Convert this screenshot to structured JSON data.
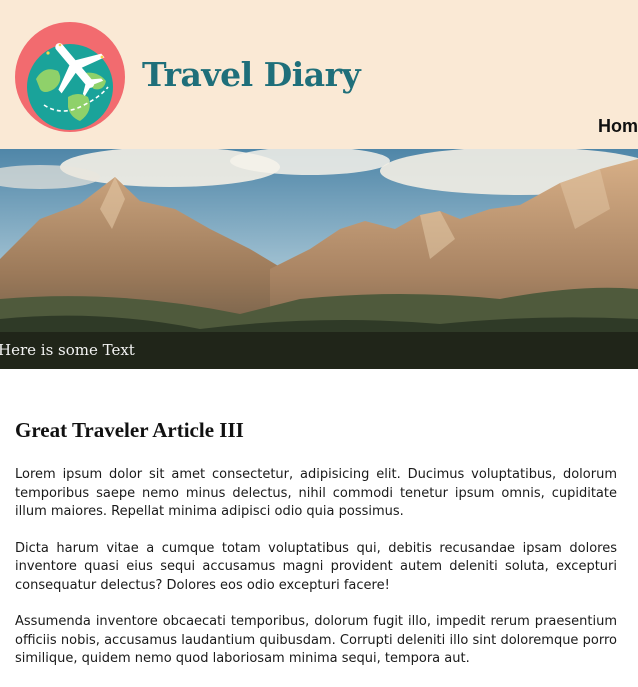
{
  "header": {
    "site_title": "Travel Diary",
    "logo_icon": "globe-airplane-icon",
    "colors": {
      "background": "#fae9d5",
      "title": "#1f6f7a",
      "logo_circle": "#f26b6f",
      "globe": "#1aa39a"
    }
  },
  "nav": {
    "home_label": "Hom"
  },
  "hero": {
    "image": "mountain-landscape",
    "caption": "Here is some Text"
  },
  "article": {
    "title": "Great Traveler Article III",
    "paragraphs": [
      "Lorem ipsum dolor sit amet consectetur, adipisicing elit. Ducimus voluptatibus, dolorum temporibus saepe nemo minus delectus, nihil commodi tenetur ipsum omnis, cupiditate illum maiores. Repellat minima adipisci odio quia possimus.",
      "Dicta harum vitae a cumque totam voluptatibus qui, debitis recusandae ipsam dolores inventore quasi eius sequi accusamus magni provident autem deleniti soluta, excepturi consequatur delectus? Dolores eos odio excepturi facere!",
      "Assumenda inventore obcaecati temporibus, dolorum fugit illo, impedit rerum praesentium officiis nobis, accusamus laudantium quibusdam. Corrupti deleniti illo sint doloremque porro similique, quidem nemo quod laboriosam minima sequi, tempora aut."
    ]
  }
}
